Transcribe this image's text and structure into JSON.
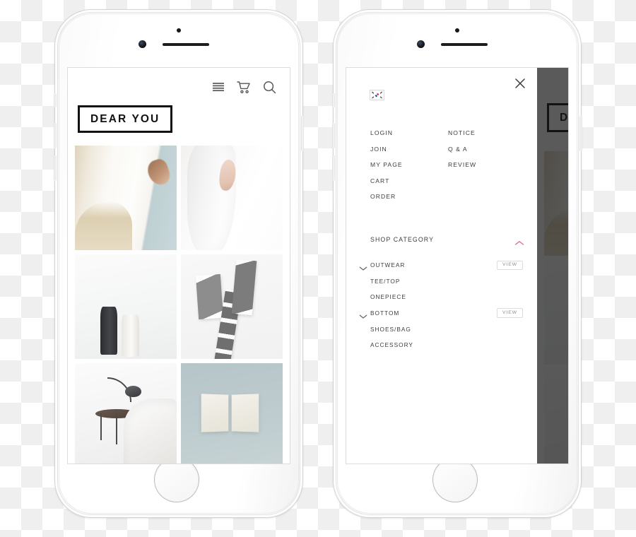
{
  "scene": {
    "description": "Two white smartphones side by side showing a fashion e-commerce mobile site",
    "background": "transparency-checkerboard"
  },
  "phone_left": {
    "name": "storefront-phone",
    "topbar": {
      "icons": [
        {
          "name": "hamburger-menu-icon",
          "label": "Menu"
        },
        {
          "name": "shopping-cart-icon",
          "label": "Cart"
        },
        {
          "name": "search-icon",
          "label": "Search"
        }
      ]
    },
    "logo": {
      "text": "DEAR YOU"
    },
    "gallery": {
      "tiles": [
        {
          "name": "photo-curtain-window",
          "alt": "Sheer curtain and hand by window"
        },
        {
          "name": "photo-white-dress",
          "alt": "White dress detail with hand"
        },
        {
          "name": "photo-vases",
          "alt": "Black and white vases on table"
        },
        {
          "name": "photo-polaroids",
          "alt": "Black and white photo prints"
        },
        {
          "name": "photo-bedroom",
          "alt": "Bedside table with lamp and bed"
        },
        {
          "name": "photo-open-book",
          "alt": "Open map book on blue-grey background"
        }
      ]
    }
  },
  "phone_right": {
    "name": "menu-overlay-phone",
    "close_label": "×",
    "flag": {
      "name": "korea-flag-icon",
      "label": "Korean"
    },
    "menu_links": [
      {
        "label": "LOGIN",
        "col": 1
      },
      {
        "label": "NOTICE",
        "col": 2
      },
      {
        "label": "JOIN",
        "col": 1
      },
      {
        "label": "Q & A",
        "col": 2
      },
      {
        "label": "MY PAGE",
        "col": 1
      },
      {
        "label": "REVIEW",
        "col": 2
      },
      {
        "label": "CART",
        "col": 1
      },
      {
        "label": "",
        "col": 2
      },
      {
        "label": "ORDER",
        "col": 1
      },
      {
        "label": "",
        "col": 2
      }
    ],
    "shop_category": {
      "label": "SHOP CATEGORY",
      "expanded": true,
      "accent_color": "#e2727f"
    },
    "categories": [
      {
        "label": "OUTWEAR",
        "has_chevron": true,
        "view_label": "VIEW"
      },
      {
        "label": "TEE/TOP",
        "has_chevron": false,
        "view_label": ""
      },
      {
        "label": "ONEPIECE",
        "has_chevron": false,
        "view_label": ""
      },
      {
        "label": "BOTTOM",
        "has_chevron": true,
        "view_label": "VIEW"
      },
      {
        "label": "SHOES/BAG",
        "has_chevron": false,
        "view_label": ""
      },
      {
        "label": "ACCESSORY",
        "has_chevron": false,
        "view_label": ""
      }
    ],
    "dimmed_page": {
      "logo_text": "DEAR YOU",
      "overlay_color": "#141414"
    }
  }
}
